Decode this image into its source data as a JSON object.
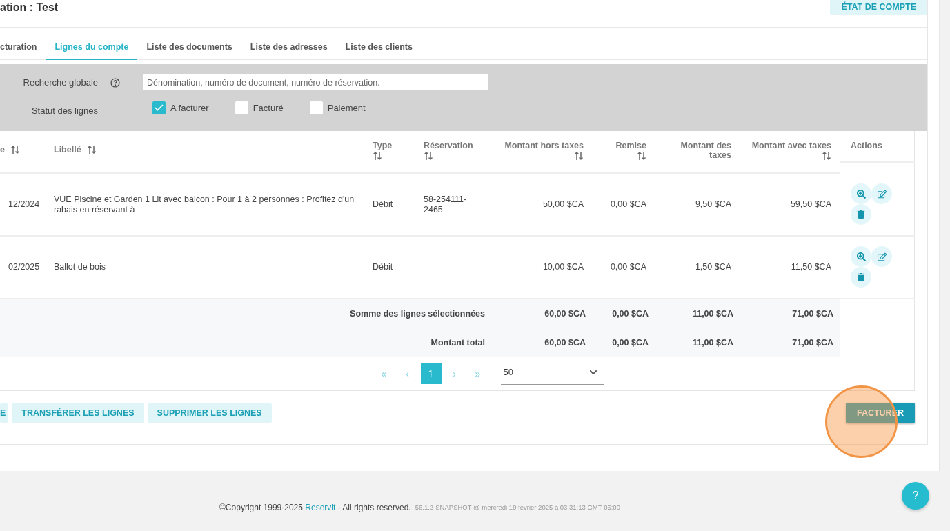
{
  "page_title": "ation : Test",
  "statement_button": "ÉTAT DE COMPTE",
  "tabs": [
    {
      "label": "cturation",
      "selected": false
    },
    {
      "label": "Lignes du compte",
      "selected": true
    },
    {
      "label": "Liste des documents",
      "selected": false
    },
    {
      "label": "Liste des adresses",
      "selected": false
    },
    {
      "label": "Liste des clients",
      "selected": false
    }
  ],
  "filters": {
    "search": {
      "label": "Recherche globale",
      "placeholder": "Dénomination, numéro de document, numéro de réservation."
    },
    "status": {
      "label": "Statut des lignes",
      "options": [
        {
          "label": "A facturer",
          "checked": true
        },
        {
          "label": "Facturé",
          "checked": false
        },
        {
          "label": "Paiement",
          "checked": false
        }
      ]
    }
  },
  "table": {
    "columns": [
      {
        "label": "e",
        "kind": "text",
        "sortable": true
      },
      {
        "label": "Libellé",
        "kind": "text",
        "sortable": true
      },
      {
        "label": "Type",
        "kind": "stacked",
        "sortable": true
      },
      {
        "label": "Réservation",
        "kind": "stacked",
        "sortable": true
      },
      {
        "label": "Montant hors taxes",
        "kind": "amount",
        "sortable": true
      },
      {
        "label": "Remise",
        "kind": "amount",
        "sortable": true
      },
      {
        "label": "Montant des taxes",
        "kind": "amount",
        "sortable": false
      },
      {
        "label": "Montant avec taxes",
        "kind": "amount",
        "sortable": true
      },
      {
        "label": "Actions",
        "kind": "actions",
        "sortable": false
      }
    ],
    "rows": [
      {
        "cells": [
          "12/2024",
          "VUE Piscine et Garden 1 Lit avec balcon : Pour 1 à 2 personnes : Profitez d'un rabais en réservant à",
          "Débit",
          "58-254111-2465",
          "50,00 $CA",
          "0,00 $CA",
          "9,50 $CA",
          "59,50 $CA"
        ]
      },
      {
        "cells": [
          "02/2025",
          "Ballot de bois",
          "Débit",
          "",
          "10,00 $CA",
          "0,00 $CA",
          "1,50 $CA",
          "11,50 $CA"
        ]
      }
    ],
    "summary_rows": [
      {
        "label": "Somme des lignes sélectionnées",
        "values": [
          "60,00 $CA",
          "0,00 $CA",
          "11,00 $CA",
          "71,00 $CA"
        ]
      },
      {
        "label": "Montant total",
        "values": [
          "60,00 $CA",
          "0,00 $CA",
          "11,00 $CA",
          "71,00 $CA"
        ]
      }
    ],
    "pagination": {
      "first": "«",
      "previous": "‹",
      "pages": [
        {
          "label": "1",
          "selected": true
        }
      ],
      "next": "›",
      "last": "»",
      "page_size": "50"
    }
  },
  "buttons": [
    "E",
    "TRANSFÉRER LES LIGNES",
    "SUPPRIMER LES LIGNES"
  ],
  "primary_button": "FACTURER",
  "footer": {
    "copyright": "©Copyright 1999-2025 ",
    "link": "Reservit",
    "rights": " - All rights reserved.",
    "version": "56.1.2-SNAPSHOT @ mercredi 19 février 2025 à 03:31:13 GMT-05:00"
  },
  "help_button": "?"
}
